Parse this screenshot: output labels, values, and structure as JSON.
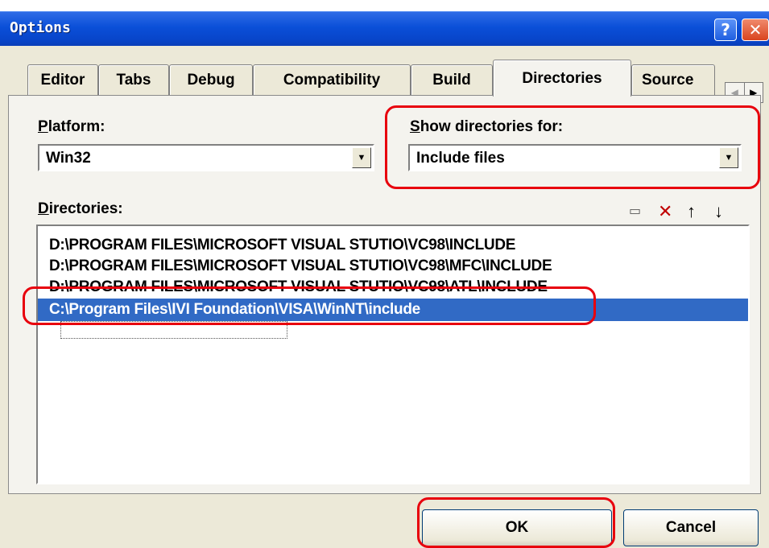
{
  "window": {
    "title": "Options",
    "help_glyph": "?",
    "close_glyph": "✕"
  },
  "tabs": [
    {
      "label": "Editor"
    },
    {
      "label": "Tabs"
    },
    {
      "label": "Debug"
    },
    {
      "label": "Compatibility"
    },
    {
      "label": "Build"
    },
    {
      "label": "Directories",
      "active": true
    },
    {
      "label": "Source"
    }
  ],
  "platform": {
    "label_underlined": "P",
    "label_rest": "latform:",
    "value": "Win32"
  },
  "show_dirs": {
    "label_underlined": "S",
    "label_rest": "how directories for:",
    "value": "Include files"
  },
  "directories": {
    "label_underlined": "D",
    "label_rest": "irectories:",
    "items": [
      "D:\\PROGRAM FILES\\MICROSOFT VISUAL STUTIO\\VC98\\INCLUDE",
      "D:\\PROGRAM FILES\\MICROSOFT VISUAL STUTIO\\VC98\\MFC\\INCLUDE",
      "D:\\PROGRAM FILES\\MICROSOFT VISUAL STUTIO\\VC98\\ATL\\INCLUDE",
      "C:\\Program Files\\IVI Foundation\\VISA\\WinNT\\include"
    ],
    "selected_index": 3
  },
  "buttons": {
    "ok": "OK",
    "cancel": "Cancel"
  },
  "colors": {
    "annotation": "#e8000d",
    "selection": "#316ac5"
  }
}
